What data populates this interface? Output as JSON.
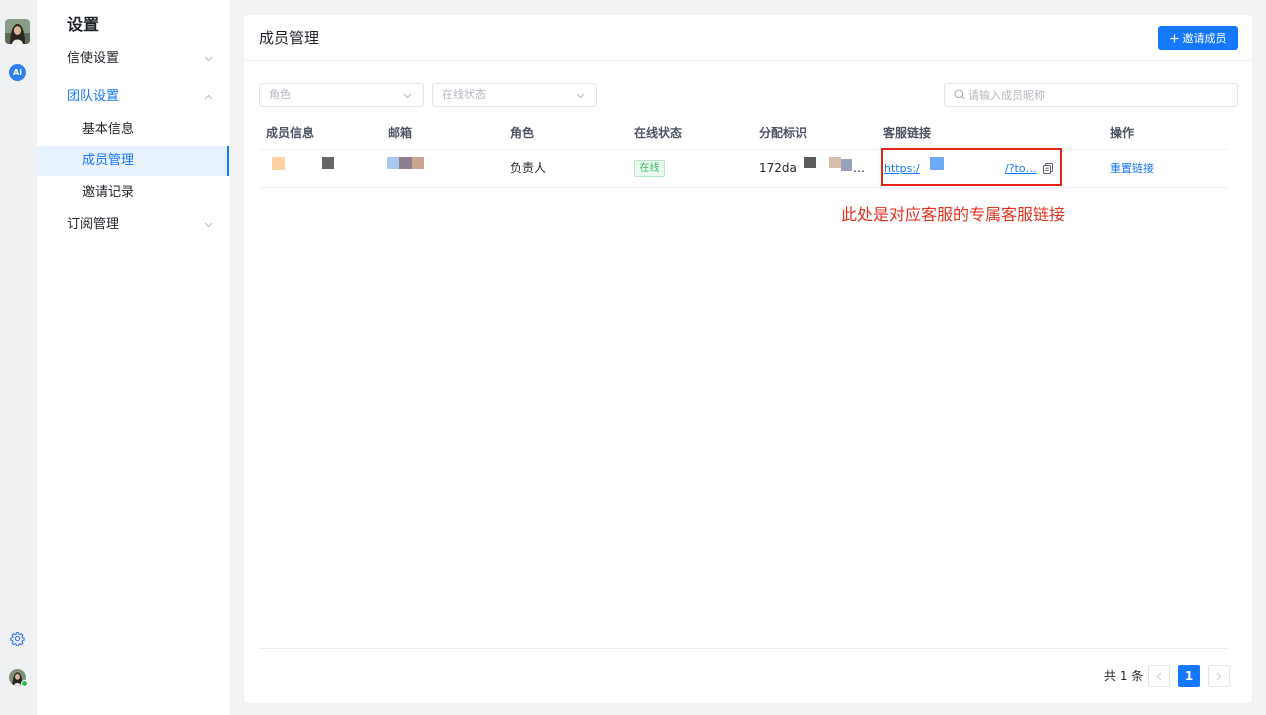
{
  "colors": {
    "accent": "#1677ff",
    "online_badge": "#3bb56b",
    "annotation": "#e5321f",
    "highlight_box": "#e3241a"
  },
  "rail": {
    "ai_badge_label": "Ai",
    "settings_icon": "gear-icon",
    "user_online": true
  },
  "sidebar": {
    "title": "设置",
    "groups": [
      {
        "label": "信使设置",
        "expanded": false,
        "icon": "chevron-down-icon"
      },
      {
        "label": "团队设置",
        "expanded": true,
        "icon": "chevron-up-icon",
        "items": [
          {
            "label": "基本信息",
            "active": false
          },
          {
            "label": "成员管理",
            "active": true
          },
          {
            "label": "邀请记录",
            "active": false
          }
        ]
      },
      {
        "label": "订阅管理",
        "expanded": false,
        "icon": "chevron-down-icon"
      }
    ]
  },
  "header": {
    "title": "成员管理",
    "invite_button": {
      "icon": "plus-icon",
      "label": "邀请成员"
    }
  },
  "filters": {
    "role": {
      "placeholder": "角色",
      "value": ""
    },
    "status": {
      "placeholder": "在线状态",
      "value": ""
    },
    "search": {
      "icon": "search-icon",
      "placeholder": "请输入成员昵称",
      "value": ""
    }
  },
  "table": {
    "columns": [
      "成员信息",
      "邮箱",
      "角色",
      "在线状态",
      "分配标识",
      "客服链接",
      "操作"
    ],
    "rows": [
      {
        "role": "负责人",
        "status": "在线",
        "assign_id": "172da",
        "assign_id_tail": "…",
        "link_head": "https:/",
        "link_tail": "/?to…",
        "link_copy_icon": "copy-icon",
        "action": "重置链接"
      }
    ]
  },
  "annotation": {
    "text": "此处是对应客服的专属客服链接"
  },
  "pagination": {
    "total": "共 1 条",
    "current_page": "1",
    "prev_disabled": true,
    "next_disabled": true
  }
}
